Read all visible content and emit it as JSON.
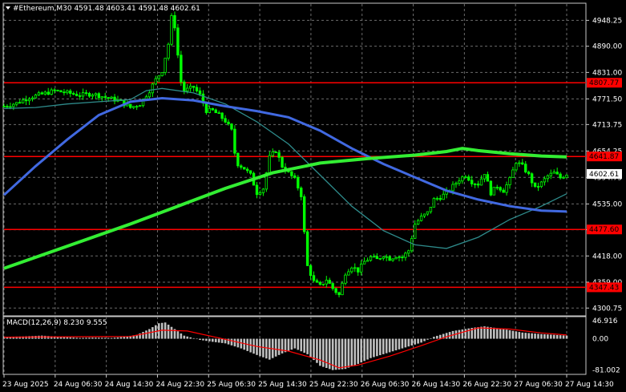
{
  "chart_data": {
    "type": "candlestick",
    "header": "#Ethereum,M30  4591.48 4603.41 4591.48 4602.61",
    "current_price": "4602.61",
    "ylim": [
      4285,
      4985
    ],
    "y_ticks": [
      "4948.25",
      "4890.00",
      "4831.00",
      "4771.50",
      "4713.75",
      "4654.25",
      "4594.75",
      "4535.00",
      "4477.00",
      "4418.00",
      "4359.00",
      "4300.75"
    ],
    "x_ticks": [
      "23 Aug 2025",
      "24 Aug 06:30",
      "24 Aug 14:30",
      "24 Aug 22:30",
      "25 Aug 06:30",
      "25 Aug 14:30",
      "25 Aug 22:30",
      "26 Aug 06:30",
      "26 Aug 14:30",
      "26 Aug 22:30",
      "27 Aug 06:30",
      "27 Aug 14:30"
    ],
    "levels": [
      {
        "label": "4807.77",
        "value": 4807.77,
        "color": "#ff0000"
      },
      {
        "label": "4641.87",
        "value": 4641.87,
        "color": "#ff0000"
      },
      {
        "label": "4477.60",
        "value": 4477.6,
        "color": "#ff0000"
      },
      {
        "label": "4347.43",
        "value": 4347.43,
        "color": "#ff0000"
      }
    ],
    "price_marker": {
      "label": "4602.61",
      "value": 4602.61
    },
    "price_path": [
      [
        0,
        4755
      ],
      [
        4,
        4762
      ],
      [
        8,
        4775
      ],
      [
        12,
        4782
      ],
      [
        16,
        4790
      ],
      [
        20,
        4785
      ],
      [
        24,
        4780
      ],
      [
        28,
        4783
      ],
      [
        32,
        4775
      ],
      [
        36,
        4768
      ],
      [
        40,
        4752
      ],
      [
        43,
        4760
      ],
      [
        46,
        4790
      ],
      [
        48,
        4815
      ],
      [
        50,
        4835
      ],
      [
        52,
        4895
      ],
      [
        53,
        4955
      ],
      [
        54,
        4935
      ],
      [
        55,
        4870
      ],
      [
        56,
        4810
      ],
      [
        57,
        4790
      ],
      [
        60,
        4798
      ],
      [
        62,
        4780
      ],
      [
        64,
        4745
      ],
      [
        66,
        4745
      ],
      [
        68,
        4735
      ],
      [
        70,
        4722
      ],
      [
        72,
        4700
      ],
      [
        73,
        4650
      ],
      [
        74,
        4625
      ],
      [
        76,
        4615
      ],
      [
        78,
        4600
      ],
      [
        80,
        4560
      ],
      [
        82,
        4570
      ],
      [
        84,
        4640
      ],
      [
        86,
        4655
      ],
      [
        88,
        4620
      ],
      [
        90,
        4605
      ],
      [
        92,
        4590
      ],
      [
        94,
        4555
      ],
      [
        95,
        4470
      ],
      [
        96,
        4395
      ],
      [
        98,
        4360
      ],
      [
        100,
        4350
      ],
      [
        102,
        4365
      ],
      [
        104,
        4345
      ],
      [
        106,
        4330
      ],
      [
        108,
        4380
      ],
      [
        110,
        4395
      ],
      [
        112,
        4385
      ],
      [
        114,
        4405
      ],
      [
        116,
        4415
      ],
      [
        118,
        4410
      ],
      [
        120,
        4420
      ],
      [
        122,
        4412
      ],
      [
        124,
        4418
      ],
      [
        126,
        4415
      ],
      [
        128,
        4430
      ],
      [
        130,
        4490
      ],
      [
        132,
        4505
      ],
      [
        134,
        4515
      ],
      [
        136,
        4545
      ],
      [
        138,
        4550
      ],
      [
        140,
        4560
      ],
      [
        142,
        4575
      ],
      [
        144,
        4590
      ],
      [
        146,
        4600
      ],
      [
        148,
        4585
      ],
      [
        150,
        4580
      ],
      [
        152,
        4605
      ],
      [
        154,
        4560
      ],
      [
        156,
        4575
      ],
      [
        158,
        4565
      ],
      [
        160,
        4590
      ],
      [
        162,
        4630
      ],
      [
        164,
        4620
      ],
      [
        166,
        4600
      ],
      [
        168,
        4570
      ],
      [
        170,
        4582
      ],
      [
        172,
        4598
      ],
      [
        174,
        4605
      ],
      [
        176,
        4594
      ],
      [
        178,
        4602.61
      ]
    ],
    "ma_slow_green": [
      [
        0,
        4390
      ],
      [
        20,
        4440
      ],
      [
        40,
        4490
      ],
      [
        55,
        4530
      ],
      [
        70,
        4570
      ],
      [
        85,
        4605
      ],
      [
        100,
        4627
      ],
      [
        115,
        4637
      ],
      [
        130,
        4645
      ],
      [
        140,
        4653
      ],
      [
        145,
        4660
      ],
      [
        150,
        4655
      ],
      [
        160,
        4648
      ],
      [
        170,
        4643
      ],
      [
        178,
        4641
      ]
    ],
    "ma_mid_blue": [
      [
        0,
        4555
      ],
      [
        10,
        4620
      ],
      [
        20,
        4680
      ],
      [
        30,
        4735
      ],
      [
        40,
        4765
      ],
      [
        50,
        4773
      ],
      [
        60,
        4768
      ],
      [
        70,
        4755
      ],
      [
        80,
        4744
      ],
      [
        90,
        4730
      ],
      [
        100,
        4700
      ],
      [
        110,
        4660
      ],
      [
        120,
        4625
      ],
      [
        130,
        4595
      ],
      [
        140,
        4565
      ],
      [
        150,
        4545
      ],
      [
        160,
        4530
      ],
      [
        170,
        4520
      ],
      [
        178,
        4518
      ]
    ],
    "ma_fast_teal": [
      [
        0,
        4750
      ],
      [
        10,
        4752
      ],
      [
        20,
        4760
      ],
      [
        30,
        4765
      ],
      [
        40,
        4770
      ],
      [
        45,
        4790
      ],
      [
        50,
        4795
      ],
      [
        60,
        4785
      ],
      [
        70,
        4760
      ],
      [
        80,
        4720
      ],
      [
        90,
        4670
      ],
      [
        100,
        4600
      ],
      [
        110,
        4530
      ],
      [
        120,
        4475
      ],
      [
        130,
        4443
      ],
      [
        140,
        4435
      ],
      [
        150,
        4460
      ],
      [
        160,
        4500
      ],
      [
        170,
        4530
      ],
      [
        178,
        4558
      ]
    ],
    "macd": {
      "header": "MACD(12,26,9) 8.230 9.555",
      "ticks": [
        "46.916",
        "0.00",
        "-81.002"
      ],
      "ylim": [
        -90,
        55
      ],
      "histogram": [
        [
          0,
          5
        ],
        [
          6,
          6
        ],
        [
          12,
          8
        ],
        [
          18,
          5
        ],
        [
          24,
          2
        ],
        [
          28,
          3
        ],
        [
          34,
          2
        ],
        [
          38,
          5
        ],
        [
          42,
          10
        ],
        [
          46,
          25
        ],
        [
          49,
          40
        ],
        [
          51,
          42
        ],
        [
          54,
          25
        ],
        [
          57,
          8
        ],
        [
          62,
          -3
        ],
        [
          66,
          -8
        ],
        [
          70,
          -12
        ],
        [
          75,
          -25
        ],
        [
          80,
          -42
        ],
        [
          84,
          -54
        ],
        [
          88,
          -38
        ],
        [
          92,
          -25
        ],
        [
          96,
          -40
        ],
        [
          100,
          -70
        ],
        [
          104,
          -81
        ],
        [
          108,
          -78
        ],
        [
          112,
          -65
        ],
        [
          116,
          -50
        ],
        [
          120,
          -40
        ],
        [
          126,
          -25
        ],
        [
          132,
          -10
        ],
        [
          136,
          5
        ],
        [
          142,
          20
        ],
        [
          148,
          28
        ],
        [
          152,
          32
        ],
        [
          158,
          25
        ],
        [
          164,
          16
        ],
        [
          170,
          12
        ],
        [
          178,
          8.23
        ]
      ],
      "signal": [
        [
          0,
          4
        ],
        [
          20,
          5
        ],
        [
          40,
          6
        ],
        [
          50,
          22
        ],
        [
          58,
          20
        ],
        [
          68,
          2
        ],
        [
          80,
          -20
        ],
        [
          90,
          -32
        ],
        [
          100,
          -55
        ],
        [
          106,
          -75
        ],
        [
          112,
          -68
        ],
        [
          122,
          -45
        ],
        [
          132,
          -18
        ],
        [
          140,
          5
        ],
        [
          150,
          28
        ],
        [
          160,
          25
        ],
        [
          170,
          15
        ],
        [
          178,
          9.555
        ]
      ]
    }
  }
}
